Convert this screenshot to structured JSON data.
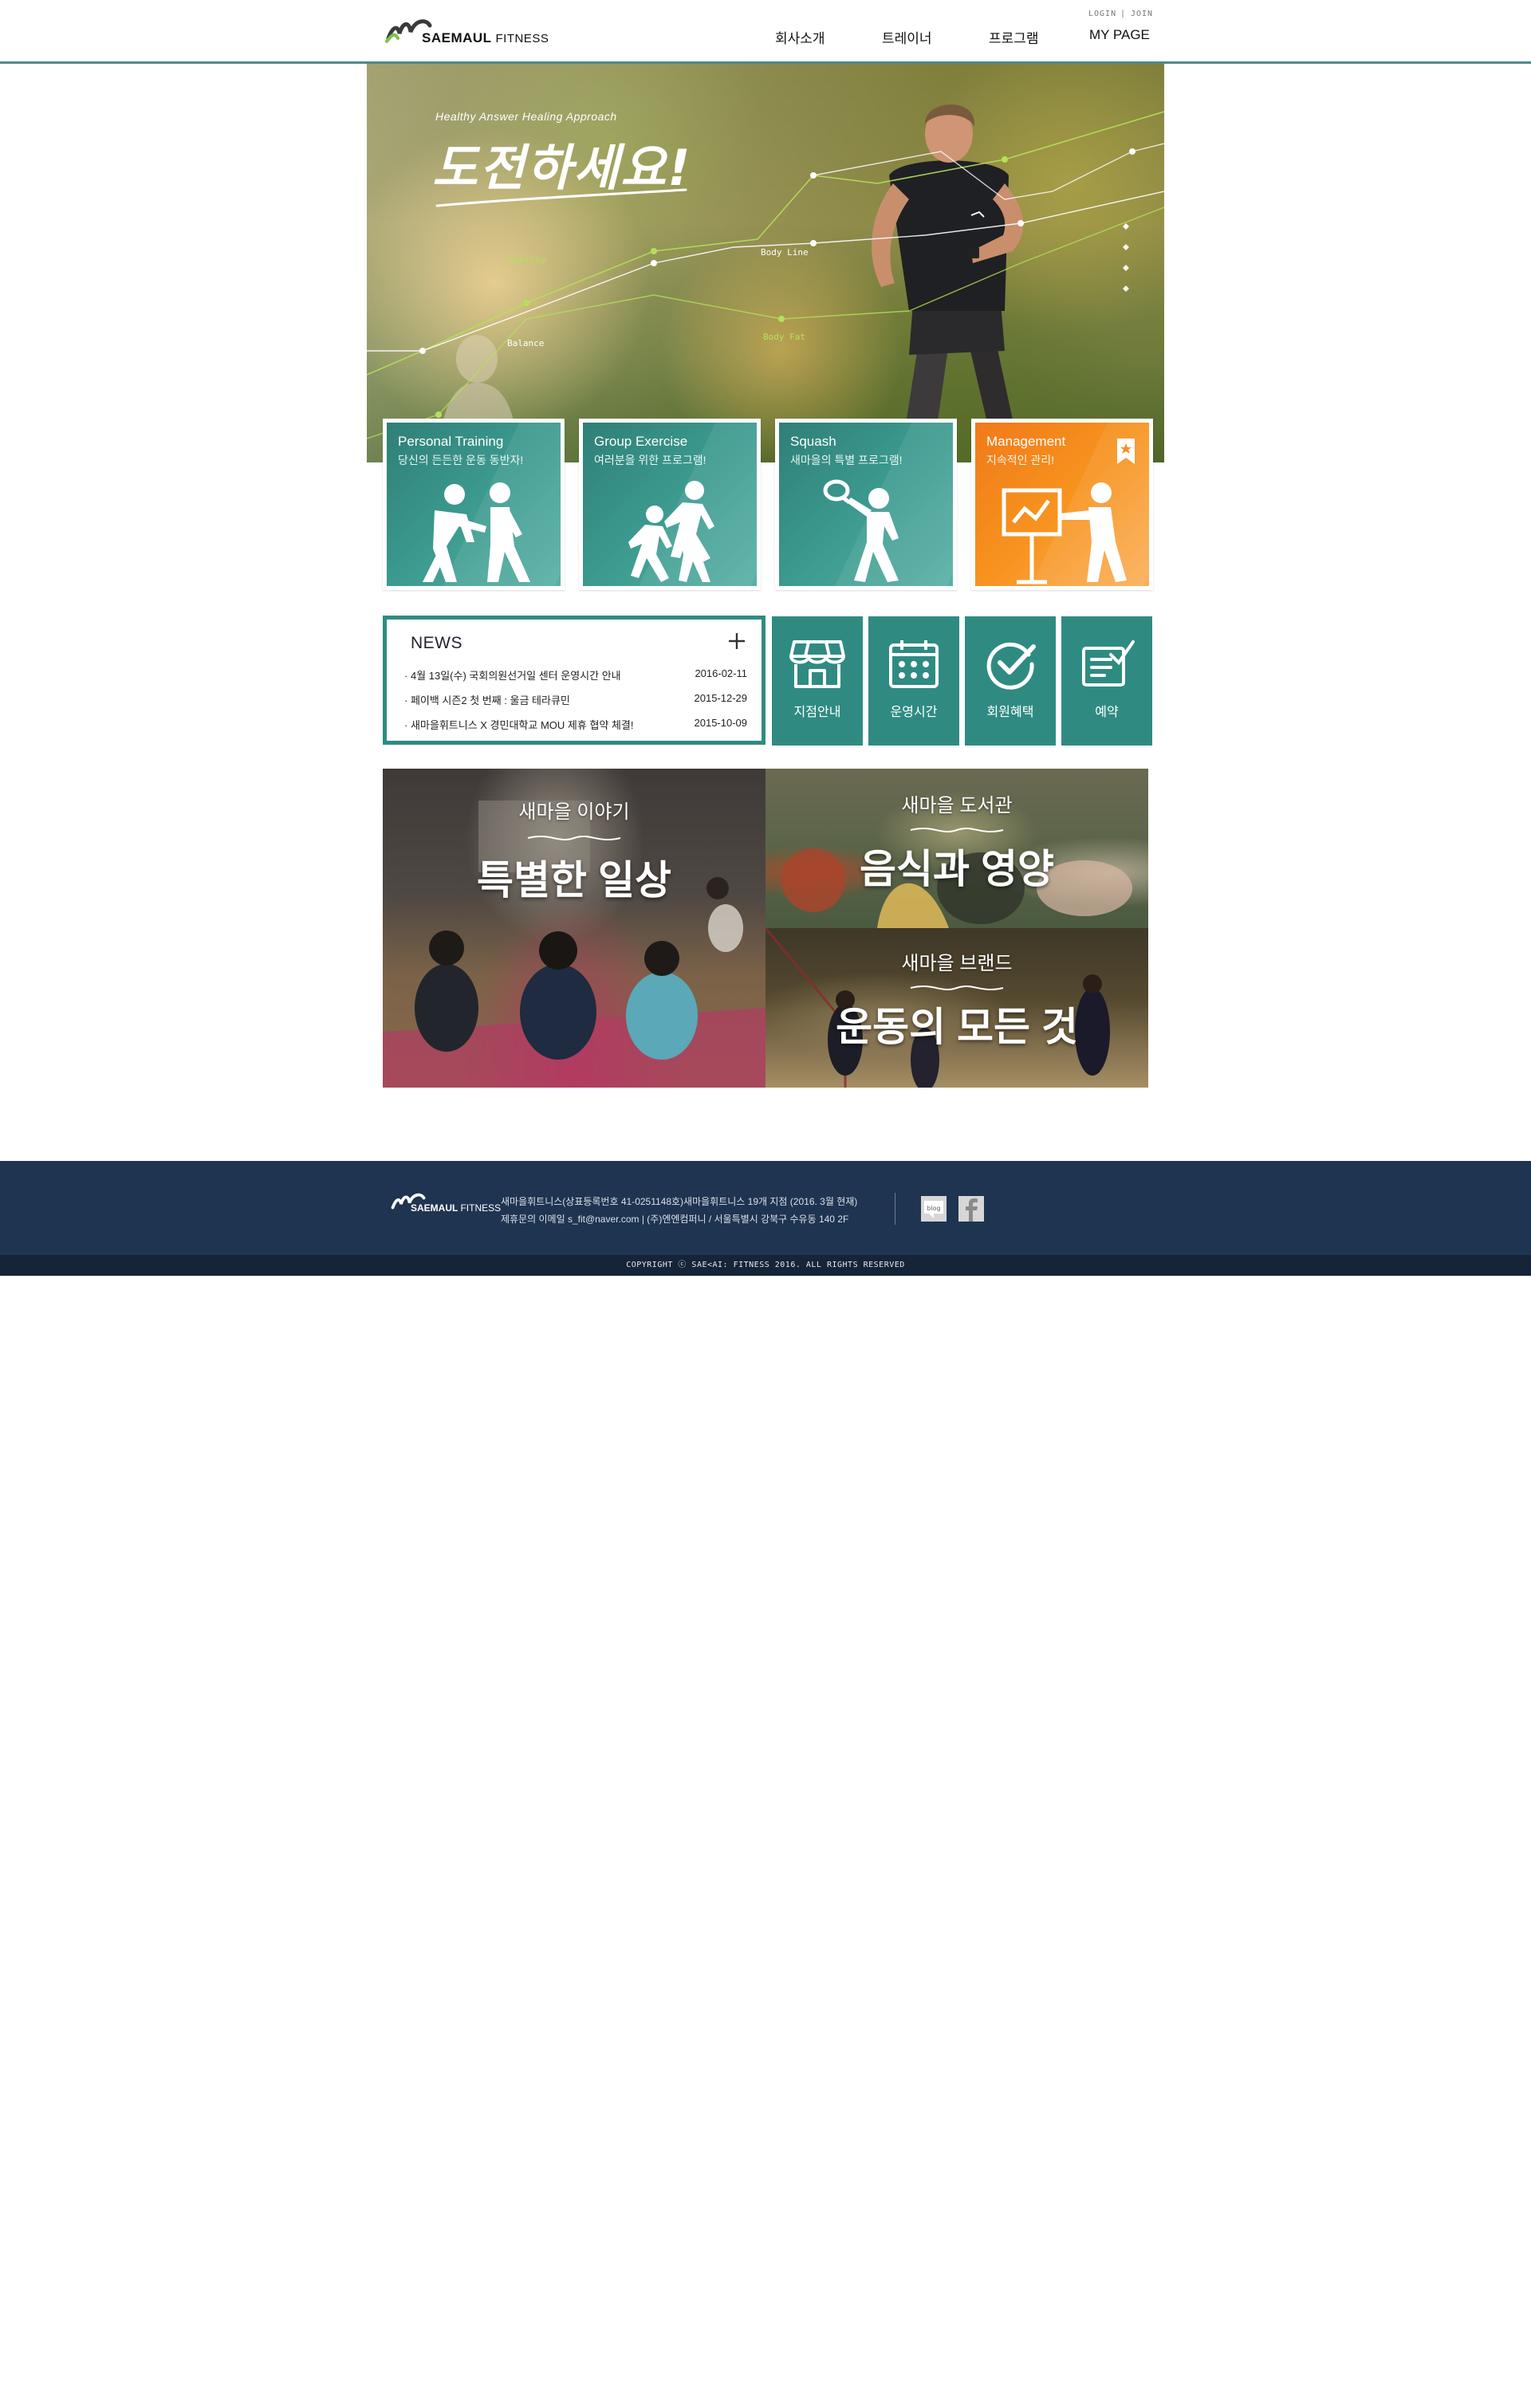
{
  "brand": {
    "name": "SAEMAUL",
    "suffix": "FITNESS"
  },
  "utility": {
    "login": "LOGIN",
    "separator": "|",
    "join": "JOIN"
  },
  "nav": [
    "회사소개",
    "트레이너",
    "프로그램",
    "MY PAGE"
  ],
  "hero": {
    "tagline": "Healthy Answer  Healing Approach",
    "headline": "도전하세요!",
    "chart_labels": [
      "Healthy",
      "Balance",
      "Body Line",
      "Body Fat"
    ]
  },
  "programs": [
    {
      "title": "Personal Training",
      "subtitle": "당신의 든든한 운동 동반자!",
      "icon": "personal-training-icon",
      "color": "#3c9a8f"
    },
    {
      "title": "Group Exercise",
      "subtitle": "여러분을 위한 프로그램!",
      "icon": "group-exercise-icon",
      "color": "#3c9a8f"
    },
    {
      "title": "Squash",
      "subtitle": "새마을의 특별 프로그램!",
      "icon": "squash-icon",
      "color": "#3c9a8f"
    },
    {
      "title": "Management",
      "subtitle": "지속적인 관리!",
      "icon": "management-icon",
      "color": "#f7931e"
    }
  ],
  "news": {
    "title": "NEWS",
    "items": [
      {
        "text": "· 4월 13일(수) 국회의원선거일 센터 운영시간 안내",
        "date": "2016-02-11"
      },
      {
        "text": "· 페이백 시즌2 첫 번째 : 울금 테라큐민",
        "date": "2015-12-29"
      },
      {
        "text": "· 새마을휘트니스 X 경민대학교 MOU 제휴 협약 체결!",
        "date": "2015-10-09"
      }
    ]
  },
  "quick_links": [
    {
      "label": "지점안내",
      "icon": "store-icon"
    },
    {
      "label": "운영시간",
      "icon": "calendar-icon"
    },
    {
      "label": "회원혜택",
      "icon": "check-icon"
    },
    {
      "label": "예약",
      "icon": "reservation-icon"
    }
  ],
  "panels": [
    {
      "top": "새마을 이야기",
      "main": "특별한 일상",
      "icon": "book-icon"
    },
    {
      "top": "새마을 도서관",
      "main": "음식과 영양",
      "icon": "lightbulb-icon"
    },
    {
      "top": "새마을 브랜드",
      "main": "운동의 모든 것",
      "icon": "tag-icon"
    }
  ],
  "footer": {
    "line1": "새마을휘트니스(상표등록번호 41-0251148호)새마을휘트니스 19개 지점 (2016. 3월 현재)",
    "line2": "제휴문의 이메일 s_fit@naver.com  |  (주)엔엔컴퍼니 / 서울특별시 강북구 수유동 140 2F",
    "social": [
      "blog",
      "facebook"
    ],
    "copyright": "COPYRIGHT ⓒ SAE<AI: FITNESS 2016. ALL RIGHTS RESERVED"
  },
  "colors": {
    "teal": "#2f8b82",
    "orange": "#f7931e",
    "navy": "#1f3450",
    "chart_line": "#b5e05a"
  }
}
